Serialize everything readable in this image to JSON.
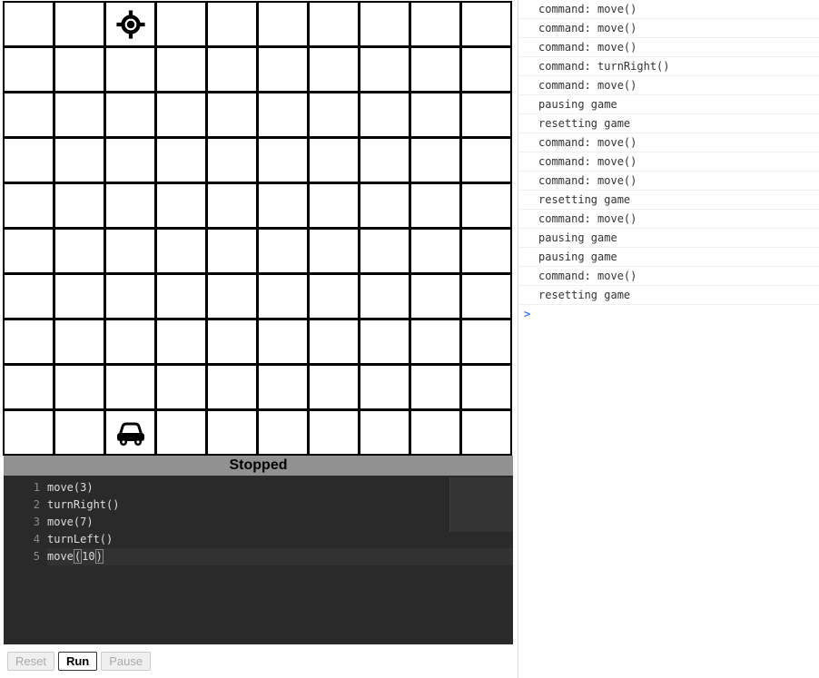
{
  "grid": {
    "rows": 10,
    "cols": 10,
    "target": {
      "row": 0,
      "col": 2
    },
    "car": {
      "row": 9,
      "col": 2
    }
  },
  "status_text": "Stopped",
  "code": {
    "lines": [
      "move(3)",
      "turnRight()",
      "move(7)",
      "turnLeft()",
      "move(10)"
    ],
    "active_line_index": 4
  },
  "buttons": {
    "reset": "Reset",
    "run": "Run",
    "pause": "Pause"
  },
  "console_log": [
    "command: move()",
    "command: move()",
    "command: move()",
    "command: turnRight()",
    "command: move()",
    "pausing game",
    "resetting game",
    "command: move()",
    "command: move()",
    "command: move()",
    "resetting game",
    "command: move()",
    "pausing game",
    "pausing game",
    "command: move()",
    "resetting game"
  ],
  "console_prompt": ">"
}
